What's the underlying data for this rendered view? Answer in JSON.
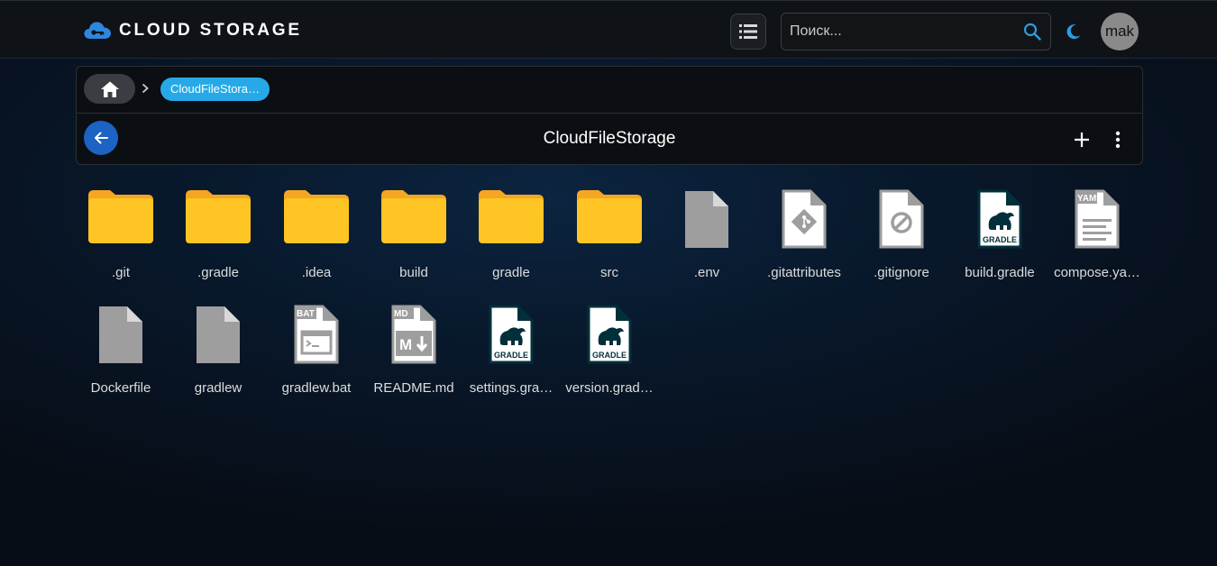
{
  "app": {
    "title": "CLOUD STORAGE",
    "logo_icon": "cloud-key-icon",
    "accent": "#27a9e8",
    "brand_blue": "#1c63c4"
  },
  "header": {
    "view_toggle_icon": "list-view-icon",
    "search": {
      "placeholder": "Поиск...",
      "value": "",
      "icon": "search-icon"
    },
    "theme_icon": "moon-icon",
    "avatar_text": "mak"
  },
  "breadcrumb": {
    "home_icon": "home-icon",
    "separator_icon": "chevron-right-icon",
    "current": "CloudFileStora…"
  },
  "toolbar": {
    "back_icon": "arrow-left-icon",
    "title": "CloudFileStorage",
    "add_icon": "plus-icon",
    "more_icon": "more-vertical-icon"
  },
  "files": [
    {
      "name": ".git",
      "type": "folder"
    },
    {
      "name": ".gradle",
      "type": "folder"
    },
    {
      "name": ".idea",
      "type": "folder"
    },
    {
      "name": "build",
      "type": "folder"
    },
    {
      "name": "gradle",
      "type": "folder"
    },
    {
      "name": "src",
      "type": "folder"
    },
    {
      "name": ".env",
      "type": "file"
    },
    {
      "name": ".gitattributes",
      "type": "git"
    },
    {
      "name": ".gitignore",
      "type": "ignore"
    },
    {
      "name": "build.gradle",
      "type": "gradle",
      "badge": "GRADLE"
    },
    {
      "name": "compose.ya…",
      "type": "yaml",
      "badge": "YAML"
    },
    {
      "name": "Dockerfile",
      "type": "file"
    },
    {
      "name": "gradlew",
      "type": "file"
    },
    {
      "name": "gradlew.bat",
      "type": "bat",
      "badge": "BAT"
    },
    {
      "name": "README.md",
      "type": "md",
      "badge": "MD"
    },
    {
      "name": "settings.gra…",
      "type": "gradle",
      "badge": "GRADLE"
    },
    {
      "name": "version.grad…",
      "type": "gradle",
      "badge": "GRADLE"
    }
  ],
  "colors": {
    "folder": "#ffc525",
    "folder_tab": "#f5a623",
    "file_gray": "#9e9e9e",
    "gradle_dark": "#02303a"
  }
}
